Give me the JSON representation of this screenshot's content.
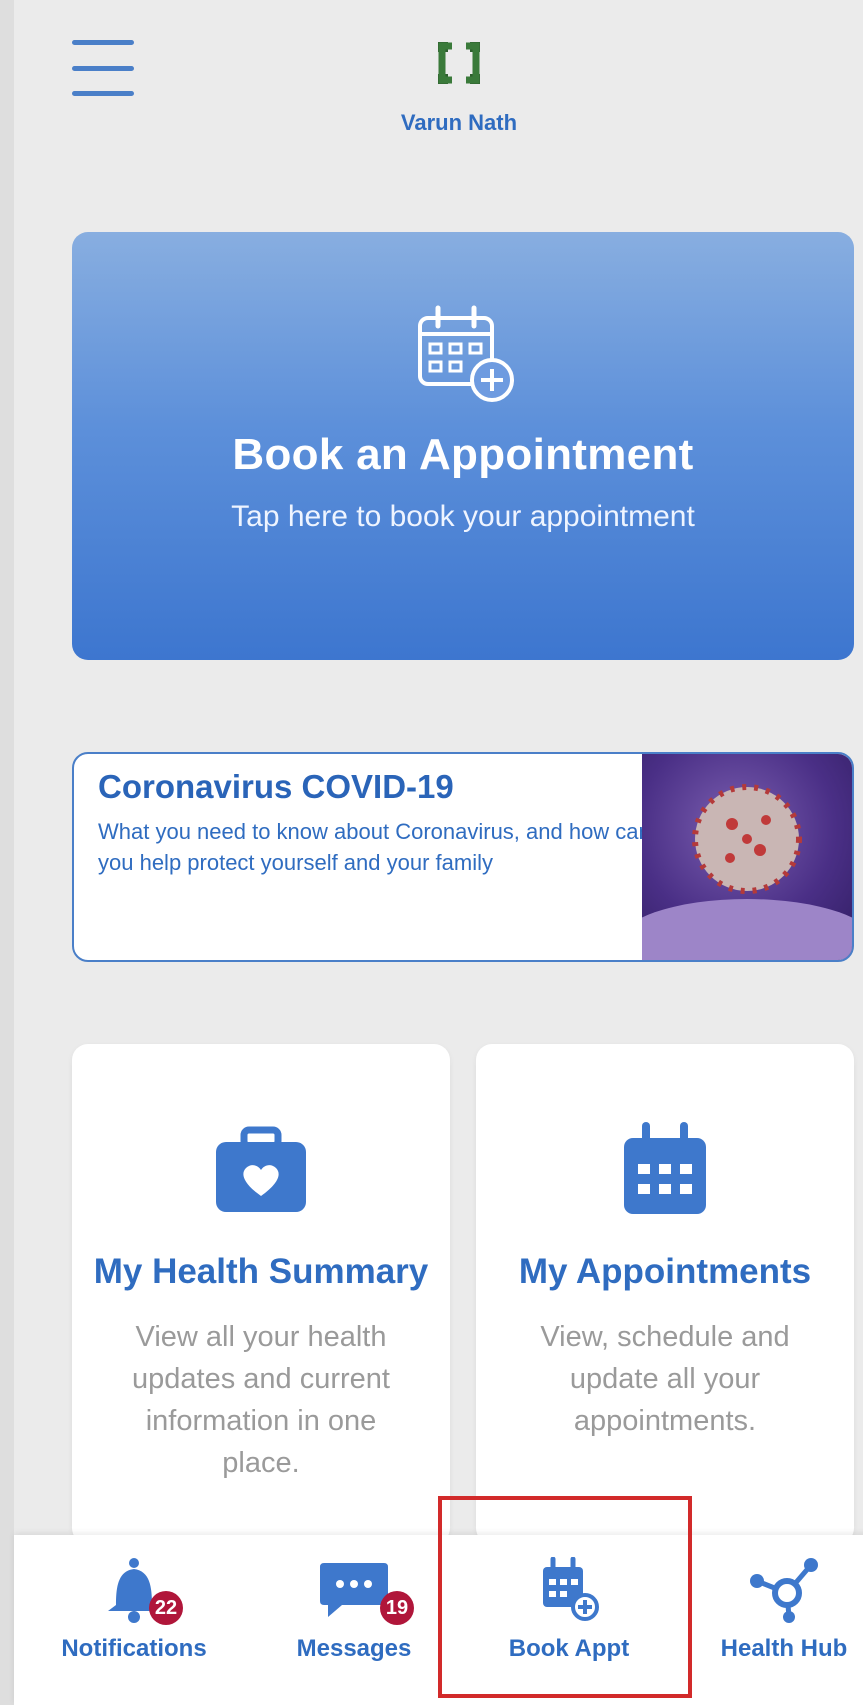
{
  "header": {
    "user_name": "Varun Nath",
    "logo_color": "#3a7a3a"
  },
  "hero": {
    "title": "Book an Appointment",
    "subtitle": "Tap here to book your appointment",
    "icon": "calendar-add-icon"
  },
  "covid_banner": {
    "title": "Coronavirus COVID-19",
    "description": "What you need to know about Coronavirus, and how can you help protect yourself and your family",
    "image": "coronavirus-image"
  },
  "cards": [
    {
      "title": "My Health Summary",
      "description": "View all your health updates and current information in one place.",
      "icon": "medical-bag-heart-icon"
    },
    {
      "title": "My Appointments",
      "description": "View, schedule and update all your appointments.",
      "icon": "calendar-icon"
    }
  ],
  "tabbar": {
    "items": [
      {
        "label": "Notifications",
        "icon": "bell-icon",
        "badge": "22"
      },
      {
        "label": "Messages",
        "icon": "chat-bubble-icon",
        "badge": "19"
      },
      {
        "label": "Book Appt",
        "icon": "calendar-add-icon",
        "badge": ""
      },
      {
        "label": "Health Hub",
        "icon": "network-hub-icon",
        "badge": ""
      }
    ]
  },
  "colors": {
    "accent": "#2f6cc0",
    "badge": "#b0163a",
    "highlight": "#d22a2a"
  }
}
